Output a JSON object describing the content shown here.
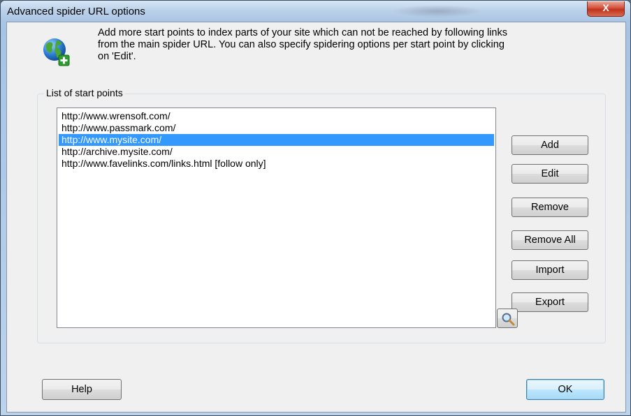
{
  "window": {
    "title": "Advanced spider URL options",
    "close_label": "X"
  },
  "header": {
    "icon": "globe-add-icon",
    "description": "Add more start points to index parts of your site which can not be reached by following links from the main spider URL. You can also specify spidering options per start point by clicking on 'Edit'."
  },
  "start_points": {
    "label": "List of start points",
    "items": [
      "http://www.wrensoft.com/",
      "http://www.passmark.com/",
      "http://www.mysite.com/",
      "http://archive.mysite.com/",
      "http://www.favelinks.com/links.html [follow only]"
    ],
    "selected_item": "http://www.mysite.com/"
  },
  "buttons": {
    "add": "Add",
    "edit": "Edit",
    "remove": "Remove",
    "remove_all": "Remove All",
    "import": "Import",
    "export": "Export",
    "search_icon": "magnifier-icon",
    "help": "Help",
    "ok": "OK"
  },
  "colors": {
    "selection": "#3399ff",
    "close_button": "#c7432d"
  }
}
